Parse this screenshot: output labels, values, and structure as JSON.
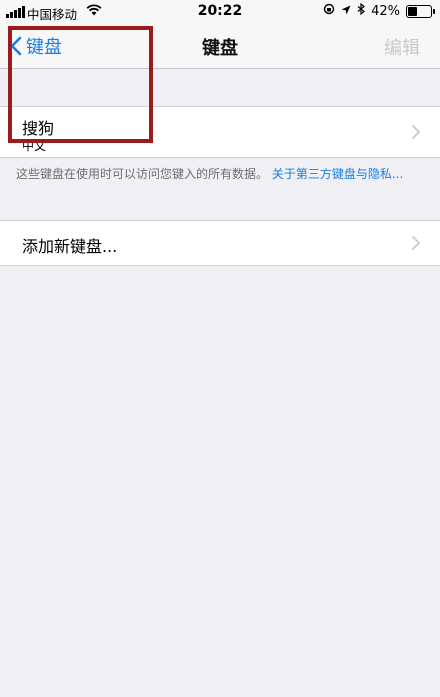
{
  "status_bar": {
    "carrier": "中国移动",
    "time": "20:22",
    "battery": "42%",
    "battery_level": 0.42
  },
  "nav": {
    "back_label": "键盘",
    "title": "键盘",
    "edit_label": "编辑"
  },
  "keyboards": [
    {
      "name": "搜狗",
      "language": "中文"
    }
  ],
  "note": {
    "text": "这些键盘在使用时可以访问您键入的所有数据。",
    "link": "关于第三方键盘与隐私..."
  },
  "add_keyboard_label": "添加新键盘...",
  "colors": {
    "accent": "#1a7ee3",
    "highlight_box": "#9b1c1c",
    "background": "#efeff4"
  }
}
